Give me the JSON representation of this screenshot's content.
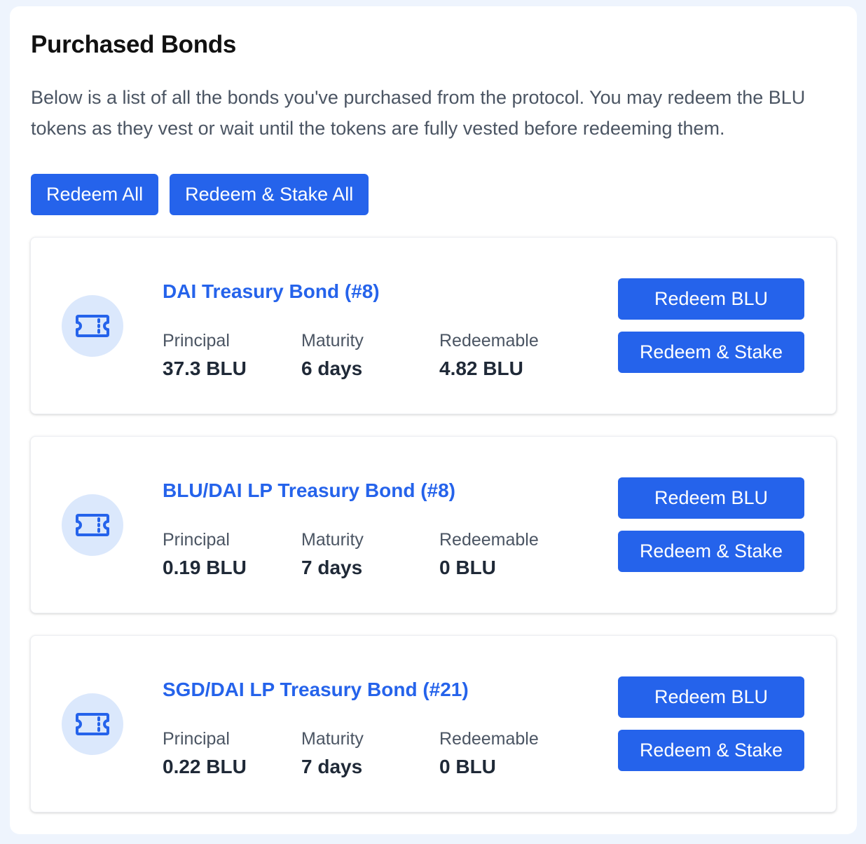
{
  "header": {
    "title": "Purchased Bonds",
    "description": "Below is a list of all the bonds you've purchased from the protocol. You may redeem the BLU tokens as they vest or wait until the tokens are fully vested before redeeming them."
  },
  "actions": {
    "redeem_all_label": "Redeem All",
    "redeem_stake_all_label": "Redeem & Stake All"
  },
  "labels": {
    "principal": "Principal",
    "maturity": "Maturity",
    "redeemable": "Redeemable",
    "redeem_button": "Redeem BLU",
    "redeem_stake_button": "Redeem & Stake"
  },
  "bonds": [
    {
      "name": "DAI Treasury Bond (#8)",
      "principal": "37.3 BLU",
      "maturity": "6 days",
      "redeemable": "4.82 BLU",
      "icon": "ticket-icon"
    },
    {
      "name": "BLU/DAI LP Treasury Bond (#8)",
      "principal": "0.19 BLU",
      "maturity": "7 days",
      "redeemable": "0 BLU",
      "icon": "ticket-icon"
    },
    {
      "name": "SGD/DAI LP Treasury Bond (#21)",
      "principal": "0.22 BLU",
      "maturity": "7 days",
      "redeemable": "0 BLU",
      "icon": "ticket-icon"
    }
  ],
  "colors": {
    "accent": "#2563eb",
    "icon_bg": "#dbe8fc",
    "page_bg": "#eef4fd",
    "muted_text": "#4b5563",
    "value_text": "#1f2937"
  }
}
